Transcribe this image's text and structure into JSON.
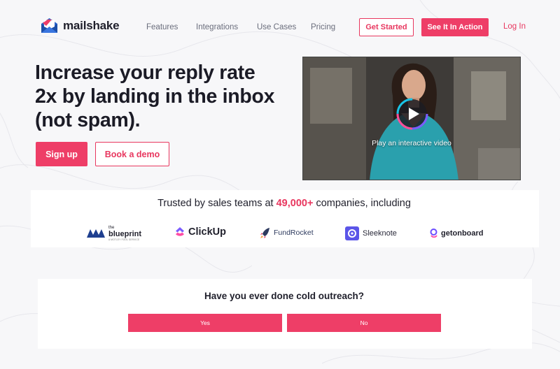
{
  "brand": {
    "name": "mailshake",
    "accent": "#ee3e67"
  },
  "nav": {
    "links": [
      "Features",
      "Integrations",
      "Use Cases",
      "Pricing"
    ],
    "get_started": "Get Started",
    "see_it": "See It In Action",
    "login": "Log In"
  },
  "hero": {
    "title_lines": [
      "Increase your reply rate",
      "2x by landing in the inbox",
      "(not spam)."
    ],
    "signup": "Sign up",
    "demo": "Book a demo"
  },
  "video": {
    "caption": "Play an interactive video"
  },
  "trusted": {
    "prefix": "Trusted by sales teams at ",
    "count": "49,000+",
    "suffix": " companies, including",
    "logos": [
      {
        "name": "the blueprint",
        "line1": "the",
        "line2": "blueprint",
        "tagline": "A MOTLEY FOOL SERVICE",
        "icon": "blueprint-icon"
      },
      {
        "name": "ClickUp",
        "icon": "clickup-icon"
      },
      {
        "name": "FundRocket",
        "icon": "rocket-icon"
      },
      {
        "name": "Sleeknote",
        "icon": "sleeknote-icon"
      },
      {
        "name": "getonboard",
        "icon": "getonboard-icon"
      }
    ]
  },
  "survey": {
    "question": "Have you ever done cold outreach?",
    "yes": "Yes",
    "no": "No"
  }
}
